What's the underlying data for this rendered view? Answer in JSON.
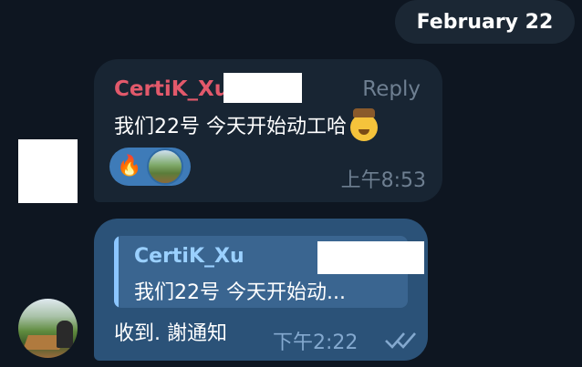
{
  "date_separator": "February 22",
  "colors": {
    "background": "#0e1621",
    "incoming_bubble": "#182533",
    "outgoing_bubble": "#2b5278",
    "sender_name": "#e2596b",
    "reaction_pill": "#3e7bb8",
    "quote_name": "#9ad0ff"
  },
  "message1": {
    "sender": "CertiK_Xu",
    "reply_label": "Reply",
    "text": "我们22号 今天开始动工哈",
    "emoji": "cowboy-face-icon",
    "reactions": {
      "emoji": "🔥",
      "reactor_avatar": "landscape-avatar-icon"
    },
    "time": "上午8:53"
  },
  "message2": {
    "quote": {
      "name": "CertiK_Xu",
      "text": "我们22号 今天开始动..."
    },
    "text": "收到. 謝通知",
    "time": "下午2:22",
    "status": "double-check-icon"
  }
}
